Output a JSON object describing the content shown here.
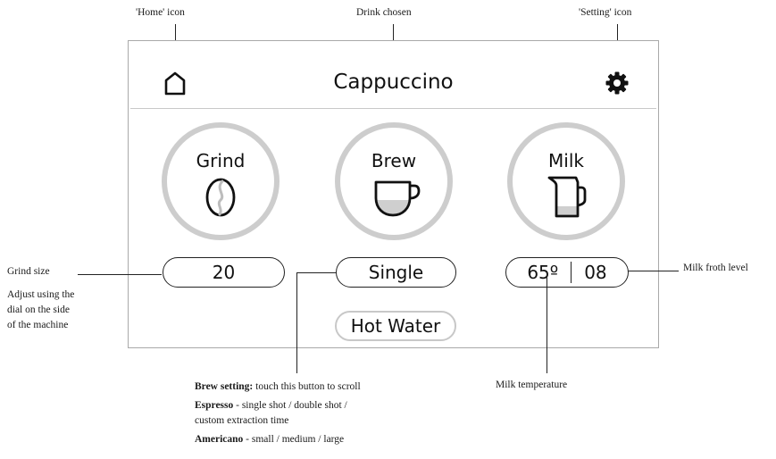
{
  "annotations": {
    "home_icon": "'Home' icon",
    "drink_chosen": "Drink chosen",
    "setting_icon": "'Setting' icon",
    "grind_size": "Grind size",
    "grind_note": [
      "Adjust using the",
      "dial on the side",
      "of the machine"
    ],
    "milk_froth_level": "Milk froth level",
    "milk_temperature": "Milk temperature",
    "brew_setting": {
      "bold": "Brew setting:",
      "text": " touch this button to scroll",
      "espresso_bold": "Espresso",
      "espresso_text_1": " - single shot / double shot /",
      "espresso_text_2": "custom extraction time",
      "americano_bold": "Americano",
      "americano_text": " - small / medium / large"
    }
  },
  "screen": {
    "drink_title": "Cappuccino",
    "home_icon": "home-icon",
    "settings_icon": "gear-icon",
    "grind": {
      "label": "Grind",
      "icon": "coffee-bean-icon",
      "value": "20"
    },
    "brew": {
      "label": "Brew",
      "icon": "cup-icon",
      "value": "Single"
    },
    "milk": {
      "label": "Milk",
      "icon": "milk-jug-icon",
      "temperature": "65º",
      "froth_level": "08"
    },
    "hot_water_label": "Hot Water"
  },
  "colors": {
    "ring": "#cdcdcd",
    "divider": "#c8c8c8",
    "fill": "#cfcfcf",
    "frame": "#a9a9a9"
  }
}
